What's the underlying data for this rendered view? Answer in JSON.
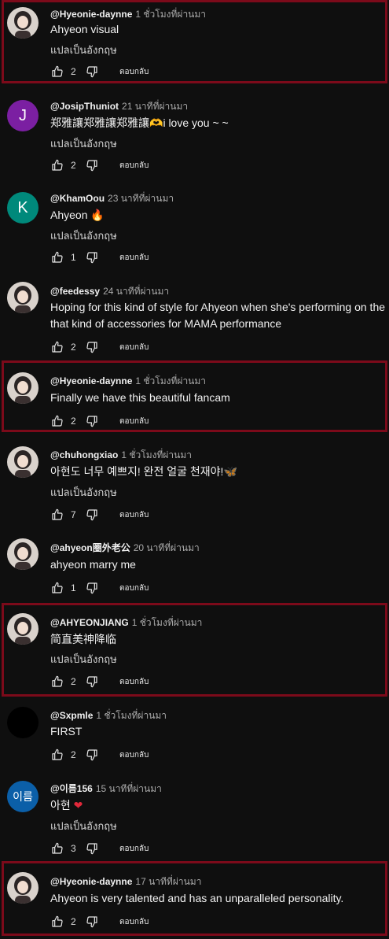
{
  "ui": {
    "translate_label": "แปลเป็นอังกฤษ",
    "reply_label": "ตอบกลับ",
    "colors": {
      "background": "#0f0f0f",
      "highlight_border": "#7c0a1a"
    }
  },
  "comments": [
    {
      "author": "@Hyeonie-daynne",
      "time": "1 ชั่วโมงที่ผ่านมา",
      "text": "Ahyeon visual",
      "likes": "2",
      "avatar": {
        "type": "photo",
        "icon": "user-photo-avatar"
      }
    },
    {
      "author": "@JosipThuniot",
      "time": "21 นาทีที่ผ่านมา",
      "text": "郑雅讓郑雅讓郑雅讓",
      "text_emoji": "🫶",
      "text_tail": "i love you ~ ~",
      "likes": "2",
      "avatar": {
        "type": "letter",
        "letter": "J",
        "color": "#7b1fa2"
      }
    },
    {
      "author": "@KhamOou",
      "time": "23 นาทีที่ผ่านมา",
      "text": "Ahyeon",
      "text_emoji": "🔥",
      "likes": "1",
      "avatar": {
        "type": "letter",
        "letter": "K",
        "color": "#00897b"
      }
    },
    {
      "author": "@feedessy",
      "time": "24 นาทีที่ผ่านมา",
      "text_line1": "Hoping for this kind of style for Ahyeon when she's performing on the",
      "text_line2": "that kind of accessories for MAMA performance",
      "likes": "2",
      "avatar": {
        "type": "photo",
        "icon": "user-photo-avatar"
      }
    },
    {
      "author": "@Hyeonie-daynne",
      "time": "1 ชั่วโมงที่ผ่านมา",
      "text": "Finally we have this beautiful fancam",
      "likes": "2",
      "avatar": {
        "type": "photo",
        "icon": "user-photo-avatar"
      }
    },
    {
      "author": "@chuhongxiao",
      "time": "1 ชั่วโมงที่ผ่านมา",
      "text": "아현도 너무 예쁘지! 완전 얼굴 천재야!",
      "text_emoji": "🦋",
      "likes": "7",
      "avatar": {
        "type": "photo",
        "icon": "user-photo-avatar"
      }
    },
    {
      "author": "@ahyeon圈外老公",
      "time": "20 นาทีที่ผ่านมา",
      "text": "ahyeon marry me",
      "likes": "1",
      "avatar": {
        "type": "photo",
        "icon": "user-photo-avatar"
      }
    },
    {
      "author": "@AHYEONJIANG",
      "time": "1 ชั่วโมงที่ผ่านมา",
      "text": "简直美神降临",
      "likes": "2",
      "avatar": {
        "type": "photo",
        "icon": "user-photo-avatar"
      }
    },
    {
      "author": "@Sxpmle",
      "time": "1 ชั่วโมงที่ผ่านมา",
      "text": "FIRST",
      "likes": "2",
      "avatar": {
        "type": "plain",
        "color": "#000000"
      }
    },
    {
      "author": "@이름156",
      "time": "15 นาทีที่ผ่านมา",
      "text": "아현",
      "text_emoji": "❤",
      "likes": "3",
      "avatar": {
        "type": "letter",
        "letter": "이름",
        "color": "#0b5fa8"
      }
    },
    {
      "author": "@Hyeonie-daynne",
      "time": "17 นาทีที่ผ่านมา",
      "text": "Ahyeon is very talented and has an unparalleled personality.",
      "likes": "2",
      "avatar": {
        "type": "photo",
        "icon": "user-photo-avatar"
      }
    }
  ]
}
